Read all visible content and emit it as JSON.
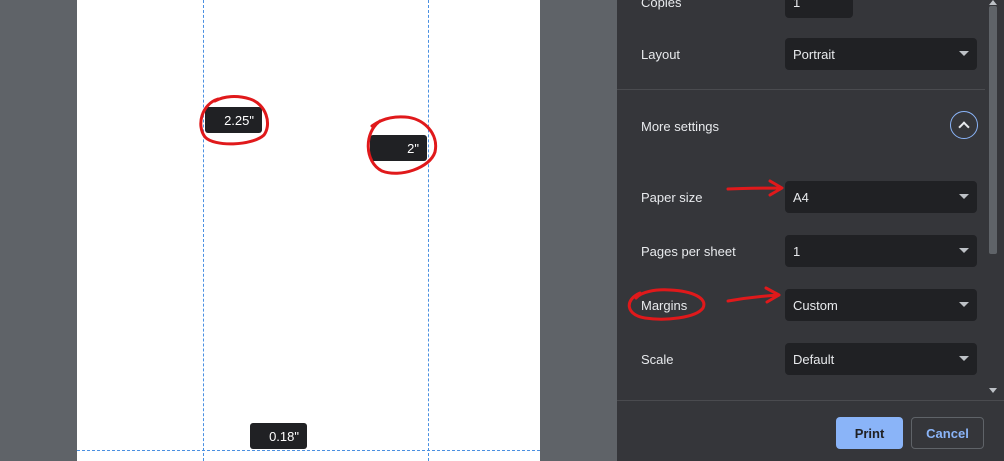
{
  "preview": {
    "margin_top_left": "2.25\"",
    "margin_top_right": "2\"",
    "margin_bottom": "0.18\""
  },
  "settings": {
    "copies": {
      "label": "Copies",
      "value": "1"
    },
    "layout": {
      "label": "Layout",
      "value": "Portrait"
    },
    "more_settings_label": "More settings",
    "paper_size": {
      "label": "Paper size",
      "value": "A4"
    },
    "pages_per_sheet": {
      "label": "Pages per sheet",
      "value": "1"
    },
    "margins": {
      "label": "Margins",
      "value": "Custom"
    },
    "scale": {
      "label": "Scale",
      "value": "Default"
    }
  },
  "footer": {
    "print_label": "Print",
    "cancel_label": "Cancel"
  },
  "colors": {
    "accent": "#8ab4f8",
    "panel_bg": "#35363a",
    "annotation": "#e0191b"
  }
}
